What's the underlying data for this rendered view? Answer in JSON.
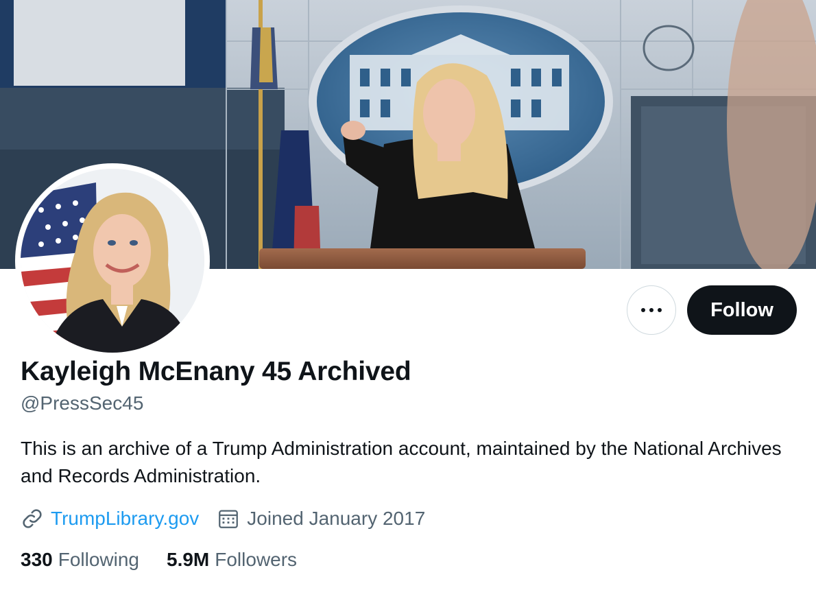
{
  "profile": {
    "display_name": "Kayleigh McEnany 45 Archived",
    "handle": "@PressSec45",
    "bio": "This is an archive of a Trump Administration account, maintained by the National Archives and Records Administration.",
    "website": "TrumpLibrary.gov",
    "joined": "Joined January 2017"
  },
  "actions": {
    "follow_label": "Follow",
    "more_icon": "more-horizontal-icon"
  },
  "stats": {
    "following_count": "330",
    "following_label": "Following",
    "followers_count": "5.9M",
    "followers_label": "Followers"
  },
  "icons": {
    "website": "link-icon",
    "joined": "calendar-icon"
  },
  "colors": {
    "link": "#1d9bf0",
    "follow_button": "#0f1419",
    "secondary_text": "#536471"
  }
}
